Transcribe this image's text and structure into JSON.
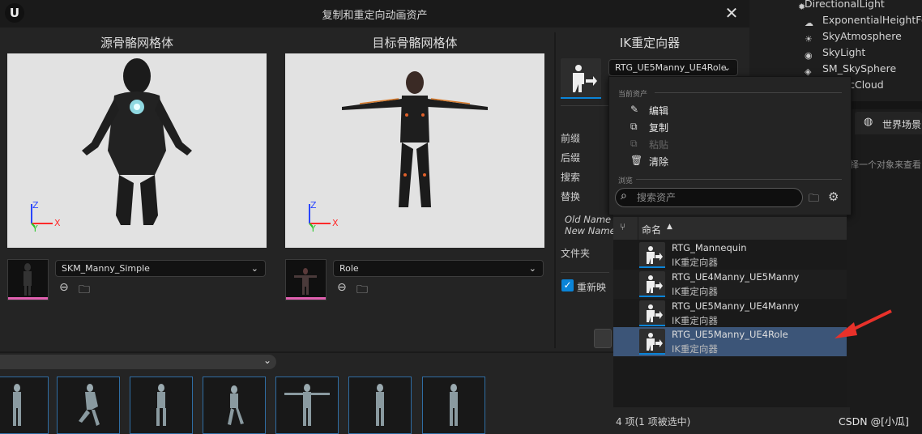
{
  "window": {
    "title": "复制和重定向动画资产",
    "logo": "U"
  },
  "source": {
    "title": "源骨骼网格体",
    "mesh": "SKM_Manny_Simple"
  },
  "target": {
    "title": "目标骨骼网格体",
    "mesh": "Role"
  },
  "retargeter": {
    "title": "IK重定向器",
    "selected": "RTG_UE5Manny_UE4Role"
  },
  "side_labels": [
    "前缀",
    "后缀",
    "搜索",
    "替换",
    "Old Name",
    "New Name",
    "文件夹",
    "重新映"
  ],
  "menu": {
    "section_current": "当前资产",
    "items": [
      {
        "label": "编辑",
        "enabled": true
      },
      {
        "label": "复制",
        "enabled": true
      },
      {
        "label": "粘贴",
        "enabled": false
      },
      {
        "label": "清除",
        "enabled": true
      }
    ],
    "section_browse": "浏览",
    "search_placeholder": "搜索资产",
    "column_name": "命名",
    "assets": [
      {
        "name": "RTG_Mannequin",
        "type": "IK重定向器",
        "selected": false
      },
      {
        "name": "RTG_UE4Manny_UE5Manny",
        "type": "IK重定向器",
        "selected": false
      },
      {
        "name": "RTG_UE5Manny_UE4Manny",
        "type": "IK重定向器",
        "selected": false
      },
      {
        "name": "RTG_UE5Manny_UE4Role",
        "type": "IK重定向器",
        "selected": true
      }
    ],
    "status": "4 项(1 项被选中)"
  },
  "outliner": [
    "DirectionalLight",
    "ExponentialHeightFog",
    "SkyAtmosphere",
    "SkyLight",
    "SM_SkySphere",
    "...etricCloud"
  ],
  "details": {
    "tab": "世界场景",
    "hint": "选择一个对象来查看"
  },
  "watermark": "CSDN @[小瓜]",
  "colors": {
    "accent_blue": "#0a84d8",
    "selected_row": "#3c5578",
    "arrow_red": "#e8312a"
  }
}
